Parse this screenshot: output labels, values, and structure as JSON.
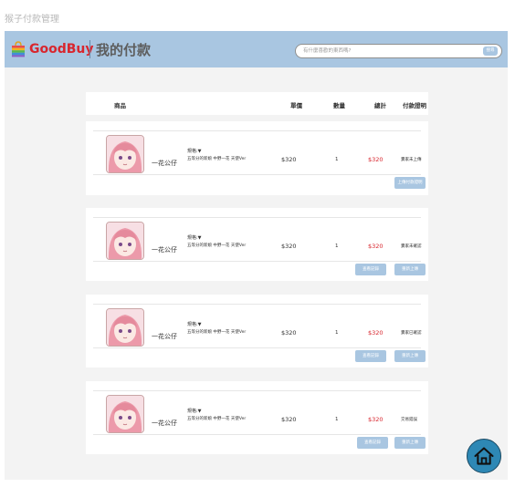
{
  "page_label": "猴子付款管理",
  "header": {
    "brand": "GoodBuy",
    "title": "我的付款",
    "search_placeholder": "有什麼喜歡的東西嗎?",
    "search_button": "搜尋"
  },
  "columns": [
    "商品",
    "單價",
    "數量",
    "總計",
    "付款證明"
  ],
  "orders": [
    {
      "name": "一花公仔",
      "spec_label": "規格:▼",
      "spec_detail": "五等分的新娘 中野一花 天使Ver",
      "price": "$320",
      "qty": "1",
      "total": "$320",
      "status": "賣家未上傳",
      "buttons": [
        "上傳付款證明"
      ]
    },
    {
      "name": "一花公仔",
      "spec_label": "規格:▼",
      "spec_detail": "五等分的新娘 中野一花 天使Ver",
      "price": "$320",
      "qty": "1",
      "total": "$320",
      "status": "賣家未確認",
      "buttons": [
        "查看記錄",
        "重新上傳"
      ]
    },
    {
      "name": "一花公仔",
      "spec_label": "規格:▼",
      "spec_detail": "五等分的新娘 中野一花 天使Ver",
      "price": "$320",
      "qty": "1",
      "total": "$320",
      "status": "賣家已確認",
      "buttons": [
        "查看記錄",
        "重新上傳"
      ]
    },
    {
      "name": "一花公仔",
      "spec_label": "規格:▼",
      "spec_detail": "五等分的新娘 中野一花 天使Ver",
      "price": "$320",
      "qty": "1",
      "total": "$320",
      "status": "交易錯誤",
      "buttons": [
        "查看記錄",
        "重新上傳"
      ]
    }
  ],
  "colors": {
    "header": "#a9c6e1",
    "accent_red": "#d8262e",
    "home_button": "#2e88b5"
  },
  "icons": {
    "logo": "shopping-bag-icon",
    "home": "home-icon"
  }
}
